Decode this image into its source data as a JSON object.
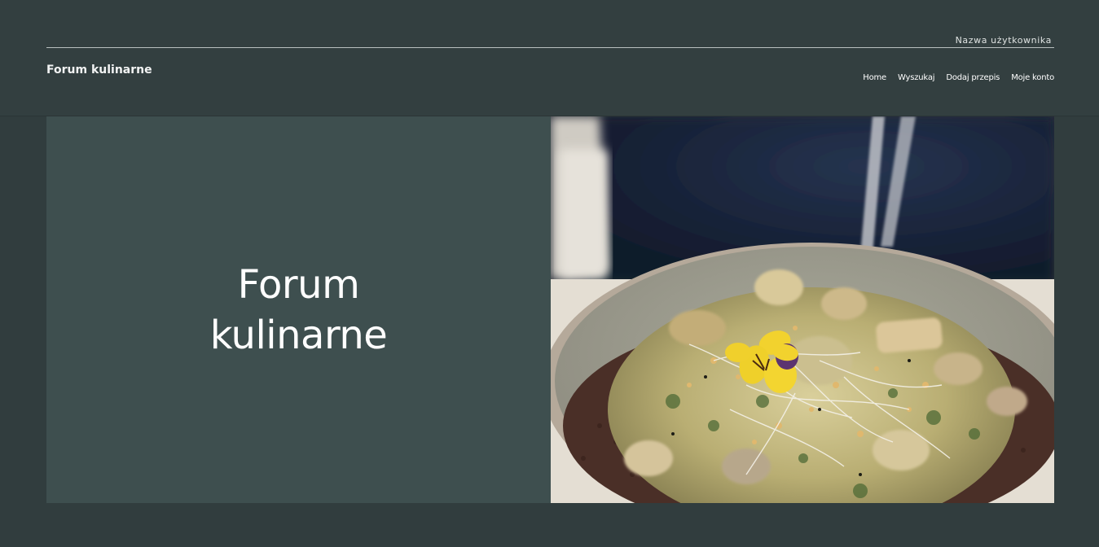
{
  "header": {
    "user_name": "Nazwa użytkownika",
    "site_title": "Forum kulinarne",
    "nav": [
      {
        "label": "Home"
      },
      {
        "label": "Wyszukaj"
      },
      {
        "label": "Dodaj przepis"
      },
      {
        "label": "Moje konto"
      }
    ]
  },
  "hero": {
    "title": "Forum kulinarne",
    "image": "food-bowl-photo"
  },
  "colors": {
    "background": "#313d3e",
    "header": "#333f40",
    "hero_panel": "#3e4f4f",
    "text": "#ffffff"
  }
}
